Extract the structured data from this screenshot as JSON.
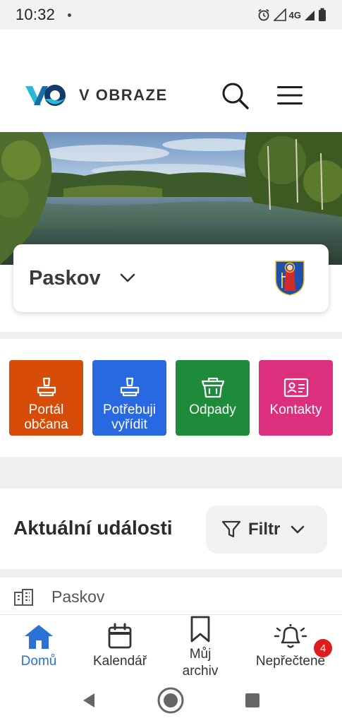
{
  "status_bar": {
    "time": "10:32",
    "network": "4G"
  },
  "header": {
    "logo_text": "V OBRAZE"
  },
  "municipality": {
    "name": "Paskov"
  },
  "tiles": [
    {
      "label": "Portál občana",
      "color": "#d64c08"
    },
    {
      "label": "Potřebuji vyřídit",
      "color": "#2868e0"
    },
    {
      "label": "Odpady",
      "color": "#1d8b3a"
    },
    {
      "label": "Kontakty",
      "color": "#dc2f7e"
    }
  ],
  "events": {
    "title": "Aktuální události",
    "filter_label": "Filtr",
    "source": "Paskov"
  },
  "bottom_nav": {
    "items": [
      {
        "label": "Domů",
        "icon": "home-icon",
        "active": true
      },
      {
        "label": "Kalendář",
        "icon": "calendar-icon"
      },
      {
        "label": "Můj archiv",
        "icon": "bookmark-icon"
      },
      {
        "label": "Nepřečtené",
        "icon": "bell-icon",
        "badge": "4"
      }
    ]
  },
  "colors": {
    "accent": "#2a72d5",
    "badge": "#e11b1b",
    "logo_teal": "#2bb7d8",
    "logo_navy": "#123a6b"
  }
}
